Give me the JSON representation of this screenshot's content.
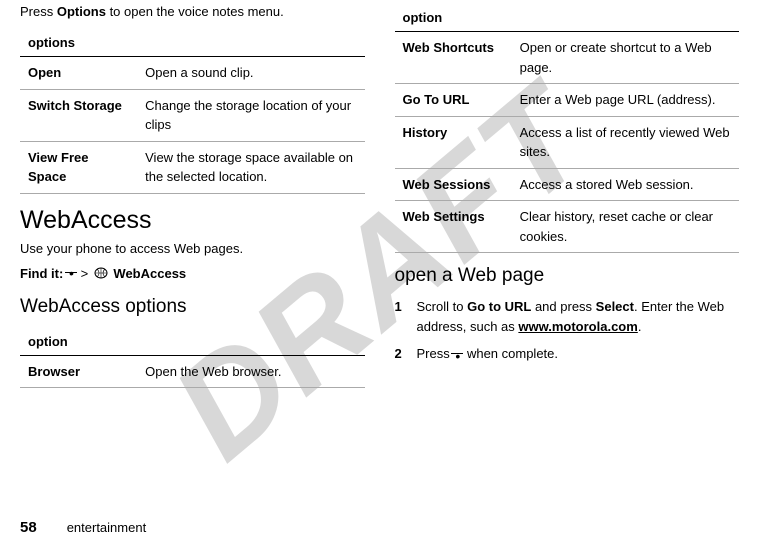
{
  "watermark": "DRAFT",
  "left": {
    "intro_pre": "Press ",
    "intro_bold": "Options",
    "intro_post": " to open the voice notes menu.",
    "table1_header": "options",
    "table1": [
      {
        "k": "Open",
        "v": "Open a sound clip."
      },
      {
        "k": "Switch Storage",
        "v": "Change the storage location of your clips"
      },
      {
        "k": "View Free Space",
        "v": "View the storage space available on the selected location."
      }
    ],
    "h1": "WebAccess",
    "sub": "Use your phone to access Web pages.",
    "findit_label": "Find it:",
    "findit_gt": ">",
    "findit_target": "WebAccess",
    "h2": "WebAccess options",
    "table2_header": "option",
    "table2": [
      {
        "k": "Browser",
        "v": "Open the Web browser."
      }
    ]
  },
  "right": {
    "table_header": "option",
    "table": [
      {
        "k": "Web Shortcuts",
        "v": "Open or create shortcut to a Web page."
      },
      {
        "k": "Go To URL",
        "v": "Enter a Web page URL (address)."
      },
      {
        "k": "History",
        "v": "Access a list of recently viewed Web sites."
      },
      {
        "k": "Web Sessions",
        "v": "Access a stored Web session."
      },
      {
        "k": "Web Settings",
        "v": "Clear history, reset cache or clear cookies."
      }
    ],
    "h2": "open a Web page",
    "step1_num": "1",
    "step1_pre": "Scroll to ",
    "step1_b1": "Go to URL",
    "step1_mid": " and press ",
    "step1_b2": "Select",
    "step1_post1": ". Enter the Web address, such as ",
    "step1_url": "www.motorola.com",
    "step1_post2": ".",
    "step2_num": "2",
    "step2_pre": "Press ",
    "step2_post": " when complete."
  },
  "footer": {
    "page": "58",
    "section": "entertainment"
  }
}
